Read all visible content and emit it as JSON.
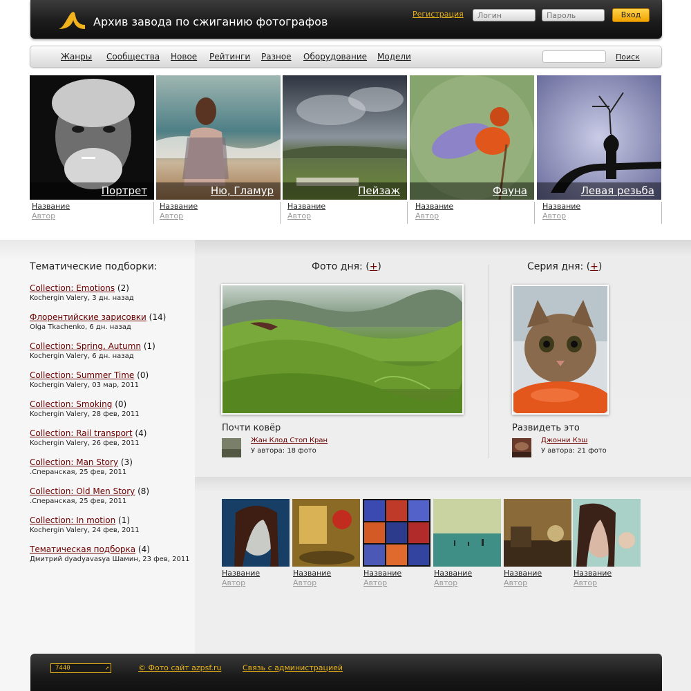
{
  "header": {
    "site_title": "Архив завода по сжиганию фотографов",
    "register_link": "Регистрация",
    "login_placeholder": "Логин",
    "password_placeholder": "Пароль",
    "enter_button": "Вход"
  },
  "nav": {
    "items": [
      "Жанры",
      "Сообщества",
      "Новое",
      "Рейтинги",
      "Разное",
      "Оборудование",
      "Модели"
    ],
    "search_button": "Поиск"
  },
  "genres": [
    {
      "label": "Портрет",
      "title": "Название",
      "author": "Автор"
    },
    {
      "label": "Ню, Гламур",
      "title": "Название",
      "author": "Автор"
    },
    {
      "label": "Пейзаж",
      "title": "Название",
      "author": "Автор"
    },
    {
      "label": "Фауна",
      "title": "Название",
      "author": "Автор"
    },
    {
      "label": "Левая резьба",
      "title": "Название",
      "author": "Автор"
    }
  ],
  "collections": {
    "heading": "Тематические подборки:",
    "items": [
      {
        "title": "Collection: Emotions",
        "count": "(2)",
        "meta": "Kochergin Valery, 3 дн. назад"
      },
      {
        "title": "Флорентийские зарисовки",
        "count": "(14)",
        "meta": "Olga Tkachenko, 6 дн. назад"
      },
      {
        "title": "Collection: Spring, Autumn",
        "count": "(1)",
        "meta": "Kochergin Valery, 6 дн. назад"
      },
      {
        "title": "Collection: Summer Time",
        "count": "(0)",
        "meta": "Kochergin Valery, 03 мар, 2011"
      },
      {
        "title": "Collection: Smoking",
        "count": "(0)",
        "meta": "Kochergin Valery, 28 фев, 2011"
      },
      {
        "title": "Collection: Rail transport",
        "count": "(4)",
        "meta": "Kochergin Valery, 26 фев, 2011"
      },
      {
        "title": "Collection: Man Story",
        "count": "(3)",
        "meta": ".Сперанская, 25 фев, 2011"
      },
      {
        "title": "Collection: Old Men Story",
        "count": "(8)",
        "meta": ".Сперанская, 25 фев, 2011"
      },
      {
        "title": "Collection: In motion",
        "count": "(1)",
        "meta": "Kochergin Valery, 24 фев, 2011"
      },
      {
        "title": "Тематическая подборка",
        "count": "(4)",
        "meta": "Дмитрий dyadyavasya Шамин, 23 фев, 2011"
      }
    ]
  },
  "photo_of_day": {
    "heading": "Фото дня:",
    "plus": "+",
    "title": "Почти ковёр",
    "author": "Жан Клод Стоп Кран",
    "author_count": "У автора: 18 фото"
  },
  "series_of_day": {
    "heading": "Серия дня:",
    "plus": "+",
    "title": "Развидеть это",
    "author": "Джонни Кэш",
    "author_count": "У автора: 21 фото"
  },
  "strip": [
    {
      "title": "Название",
      "author": "Автор"
    },
    {
      "title": "Название",
      "author": "Автор"
    },
    {
      "title": "Название",
      "author": "Автор"
    },
    {
      "title": "Название",
      "author": "Автор"
    },
    {
      "title": "Название",
      "author": "Автор"
    },
    {
      "title": "Название",
      "author": "Автор"
    }
  ],
  "footer": {
    "counter": "7440",
    "copyright": "© Фото сайт azpsf.ru",
    "contact": "Связь с администрацией"
  },
  "colors": {
    "accent_gold": "#e8b316",
    "link_dark_red": "#6b0000",
    "header_dark": "#1c1c1c"
  }
}
